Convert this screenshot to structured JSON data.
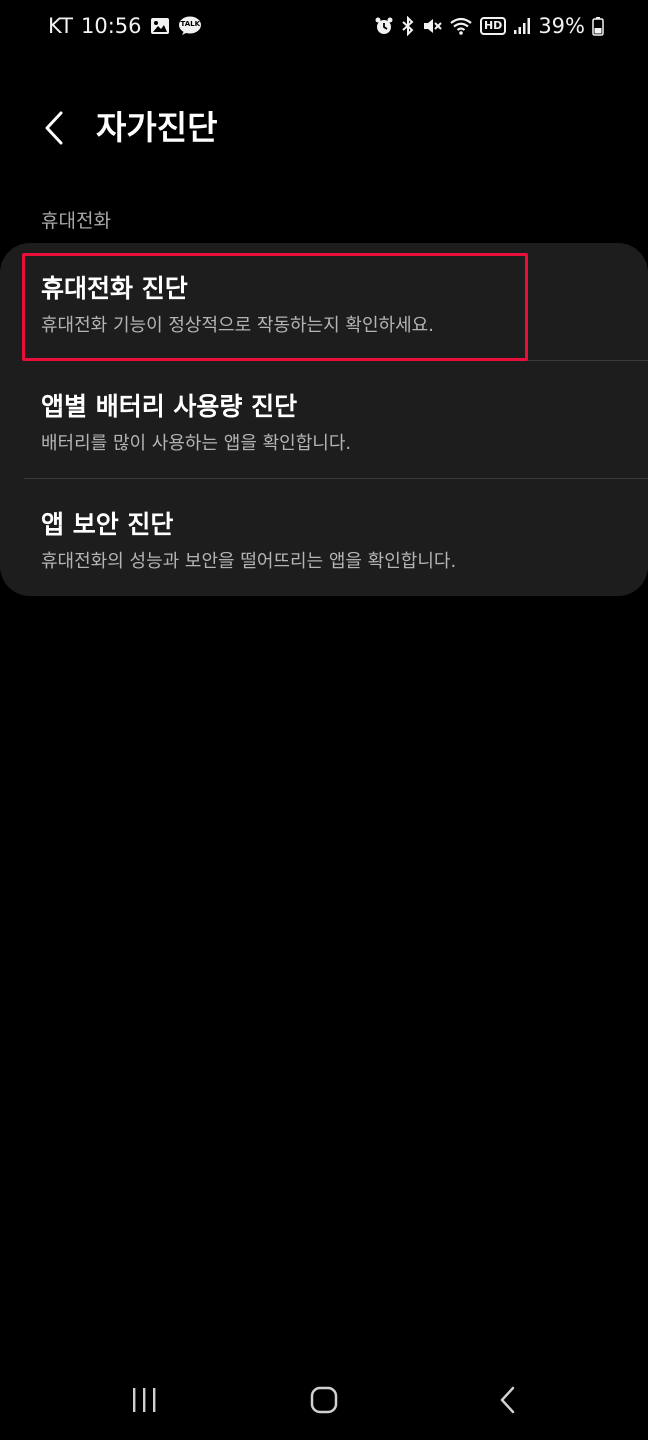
{
  "status_bar": {
    "carrier": "KT",
    "time": "10:56",
    "talk_badge": "TALK",
    "network_badge": "HD",
    "battery": "39%",
    "icons": [
      "gallery-icon",
      "kakaotalk-icon",
      "alarm-icon",
      "bluetooth-icon",
      "mute-icon",
      "wifi-icon",
      "hd-icon",
      "signal-icon",
      "battery-icon"
    ]
  },
  "header": {
    "title": "자가진단"
  },
  "section": {
    "label": "휴대전화"
  },
  "items": [
    {
      "title": "휴대전화 진단",
      "desc": "휴대전화 기능이 정상적으로 작동하는지 확인하세요."
    },
    {
      "title": "앱별 배터리 사용량 진단",
      "desc": "배터리를 많이 사용하는 앱을 확인합니다."
    },
    {
      "title": "앱 보안 진단",
      "desc": "휴대전화의 성능과 보안을 떨어뜨리는 앱을 확인합니다."
    }
  ],
  "colors": {
    "background": "#000000",
    "card": "#1d1d1d",
    "highlight": "#e8103a",
    "secondary_text": "#b4b4b4"
  }
}
